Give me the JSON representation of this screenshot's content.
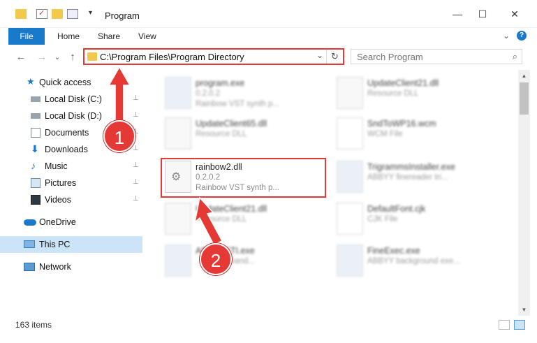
{
  "window": {
    "title": "Program",
    "minimize": "—",
    "maximize": "☐",
    "close": "✕"
  },
  "ribbon": {
    "tabs": [
      "File",
      "Home",
      "Share",
      "View"
    ],
    "expand_icon": "⌄",
    "help_icon": "?"
  },
  "nav": {
    "back": "←",
    "forward": "→",
    "recent": "⌄",
    "up": "↑",
    "address_path": "C:\\Program Files\\Program Directory",
    "address_dropdown": "⌄",
    "refresh": "↻",
    "search_placeholder": "Search Program",
    "search_icon": "⌕"
  },
  "sidebar": {
    "items": [
      {
        "label": "Quick access",
        "icon": "star-icon",
        "pinned": false
      },
      {
        "label": "Local Disk (C:)",
        "icon": "drive-icon",
        "pinned": true
      },
      {
        "label": "Local Disk (D:)",
        "icon": "drive-icon",
        "pinned": true
      },
      {
        "label": "Documents",
        "icon": "documents-icon",
        "pinned": true
      },
      {
        "label": "Downloads",
        "icon": "downloads-icon",
        "pinned": true
      },
      {
        "label": "Music",
        "icon": "music-icon",
        "pinned": true
      },
      {
        "label": "Pictures",
        "icon": "pictures-icon",
        "pinned": true
      },
      {
        "label": "Videos",
        "icon": "videos-icon",
        "pinned": true
      },
      {
        "label": "OneDrive",
        "icon": "cloud-icon",
        "pinned": false
      },
      {
        "label": "This PC",
        "icon": "computer-icon",
        "pinned": false
      },
      {
        "label": "Network",
        "icon": "network-icon",
        "pinned": false
      }
    ],
    "pin_glyph": "📌"
  },
  "files": [
    {
      "name": "program.exe",
      "line2": "0.2.0.2",
      "line3": "Rainbow VST synth p...",
      "kind": "exe"
    },
    {
      "name": "UpdateClient21.dll",
      "line2": "Resource DLL",
      "line3": "",
      "kind": "dll"
    },
    {
      "name": "UpdateClient65.dll",
      "line2": "Resource DLL",
      "line3": "",
      "kind": "dll"
    },
    {
      "name": "SndToWP16.wcm",
      "line2": "WCM File",
      "line3": "",
      "kind": "doc"
    },
    {
      "name": "rainbow2.dll",
      "line2": "0.2.0.2",
      "line3": "Rainbow VST synth p...",
      "kind": "dll"
    },
    {
      "name": "TrigrammsInstaller.exe",
      "line2": "ABBYY finereader tri...",
      "line3": "",
      "kind": "app"
    },
    {
      "name": "UpdateClient21.dll",
      "line2": "Resource DLL",
      "line3": "",
      "kind": "dll"
    },
    {
      "name": "DefaultFont.cjk",
      "line2": "CJK File",
      "line3": "",
      "kind": "doc"
    },
    {
      "name": "ABBYYSTI.exe",
      "line2": "...s event hand...",
      "line3": "",
      "kind": "app"
    },
    {
      "name": "FineExec.exe",
      "line2": "ABBYY background exe...",
      "line3": "",
      "kind": "app"
    }
  ],
  "annotations": {
    "step1": "1",
    "step2": "2",
    "color": "#e53935"
  },
  "status": {
    "item_count": "163 items"
  },
  "colors": {
    "accent": "#1979ca",
    "selection": "#cce4f7",
    "highlight": "#e53935"
  }
}
